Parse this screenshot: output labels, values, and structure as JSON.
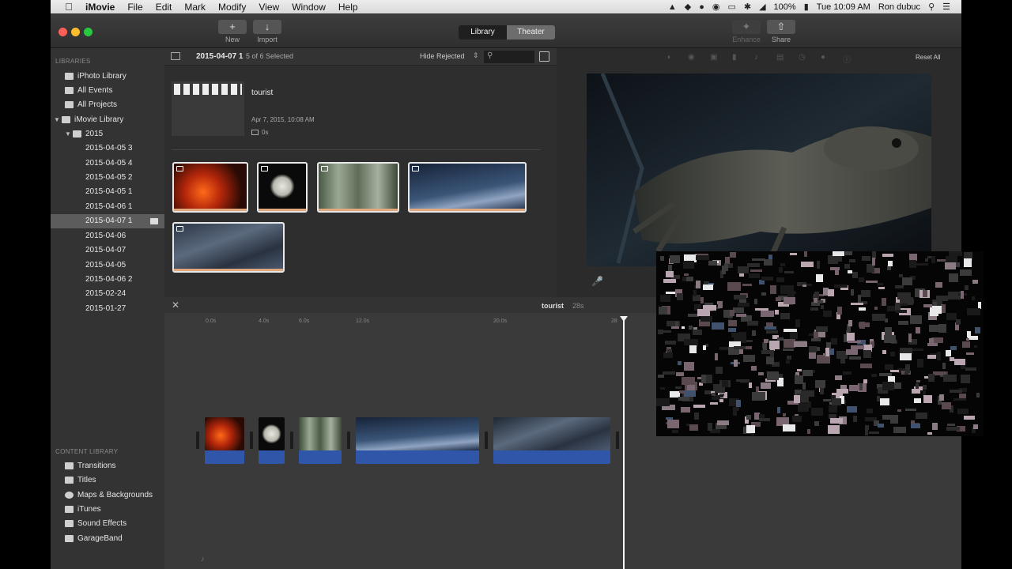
{
  "menubar": {
    "apple": "",
    "items": [
      "iMovie",
      "File",
      "Edit",
      "Mark",
      "Modify",
      "View",
      "Window",
      "Help"
    ],
    "battery": "100%",
    "clock": "Tue 10:09 AM",
    "user": "Ron dubuc"
  },
  "toolbar": {
    "new_label": "New",
    "import_label": "Import",
    "library_tab": "Library",
    "theater_tab": "Theater",
    "enhance_label": "Enhance",
    "share_label": "Share"
  },
  "sidebar": {
    "libraries_heading": "LIBRARIES",
    "items": [
      {
        "label": "iPhoto Library"
      },
      {
        "label": "All Events"
      },
      {
        "label": "All Projects"
      },
      {
        "label": "iMovie Library"
      },
      {
        "label": "2015"
      },
      {
        "label": "2015-04-05 3"
      },
      {
        "label": "2015-04-05 4"
      },
      {
        "label": "2015-04-05 2"
      },
      {
        "label": "2015-04-05 1"
      },
      {
        "label": "2015-04-06 1"
      },
      {
        "label": "2015-04-07 1"
      },
      {
        "label": "2015-04-06"
      },
      {
        "label": "2015-04-07"
      },
      {
        "label": "2015-04-05"
      },
      {
        "label": "2015-04-06 2"
      },
      {
        "label": "2015-02-24"
      },
      {
        "label": "2015-01-27"
      }
    ],
    "content_heading": "CONTENT LIBRARY",
    "content_items": [
      {
        "label": "Transitions"
      },
      {
        "label": "Titles"
      },
      {
        "label": "Maps & Backgrounds"
      },
      {
        "label": "iTunes"
      },
      {
        "label": "Sound Effects"
      },
      {
        "label": "GarageBand"
      }
    ]
  },
  "browser": {
    "event_name": "2015-04-07 1",
    "selection": "5 of 6 Selected",
    "filter": "Hide Rejected",
    "search_placeholder": "",
    "project_title": "tourist",
    "project_date": "Apr 7, 2015, 10:08 AM",
    "project_duration": "0s"
  },
  "viewer": {
    "reset_label": "Reset All"
  },
  "timeline": {
    "project_name": "tourist",
    "duration": "28s",
    "ruler": [
      "0.0s",
      "4.0s",
      "6.0s",
      "12.0s",
      "20.0s",
      "28"
    ]
  }
}
